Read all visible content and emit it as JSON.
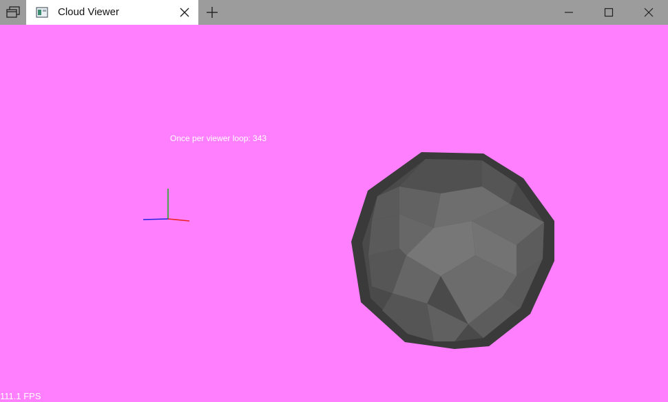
{
  "titlebar": {
    "tab_title": "Cloud Viewer",
    "icons": {
      "tabs_menu": "tab-stack-icon",
      "app": "app-window-icon",
      "tab_close": "close-icon",
      "new_tab": "plus-icon",
      "minimize": "minimize-icon",
      "maximize": "maximize-icon",
      "close": "close-icon"
    }
  },
  "viewport": {
    "background_color": "#ff7fff",
    "loop_text": "Once per viewer loop: 343",
    "fps_text": "111.1 FPS",
    "axis_colors": {
      "x": "#ff0000",
      "y": "#00aa00",
      "z": "#0000ff"
    },
    "sphere_color": "#666666"
  }
}
